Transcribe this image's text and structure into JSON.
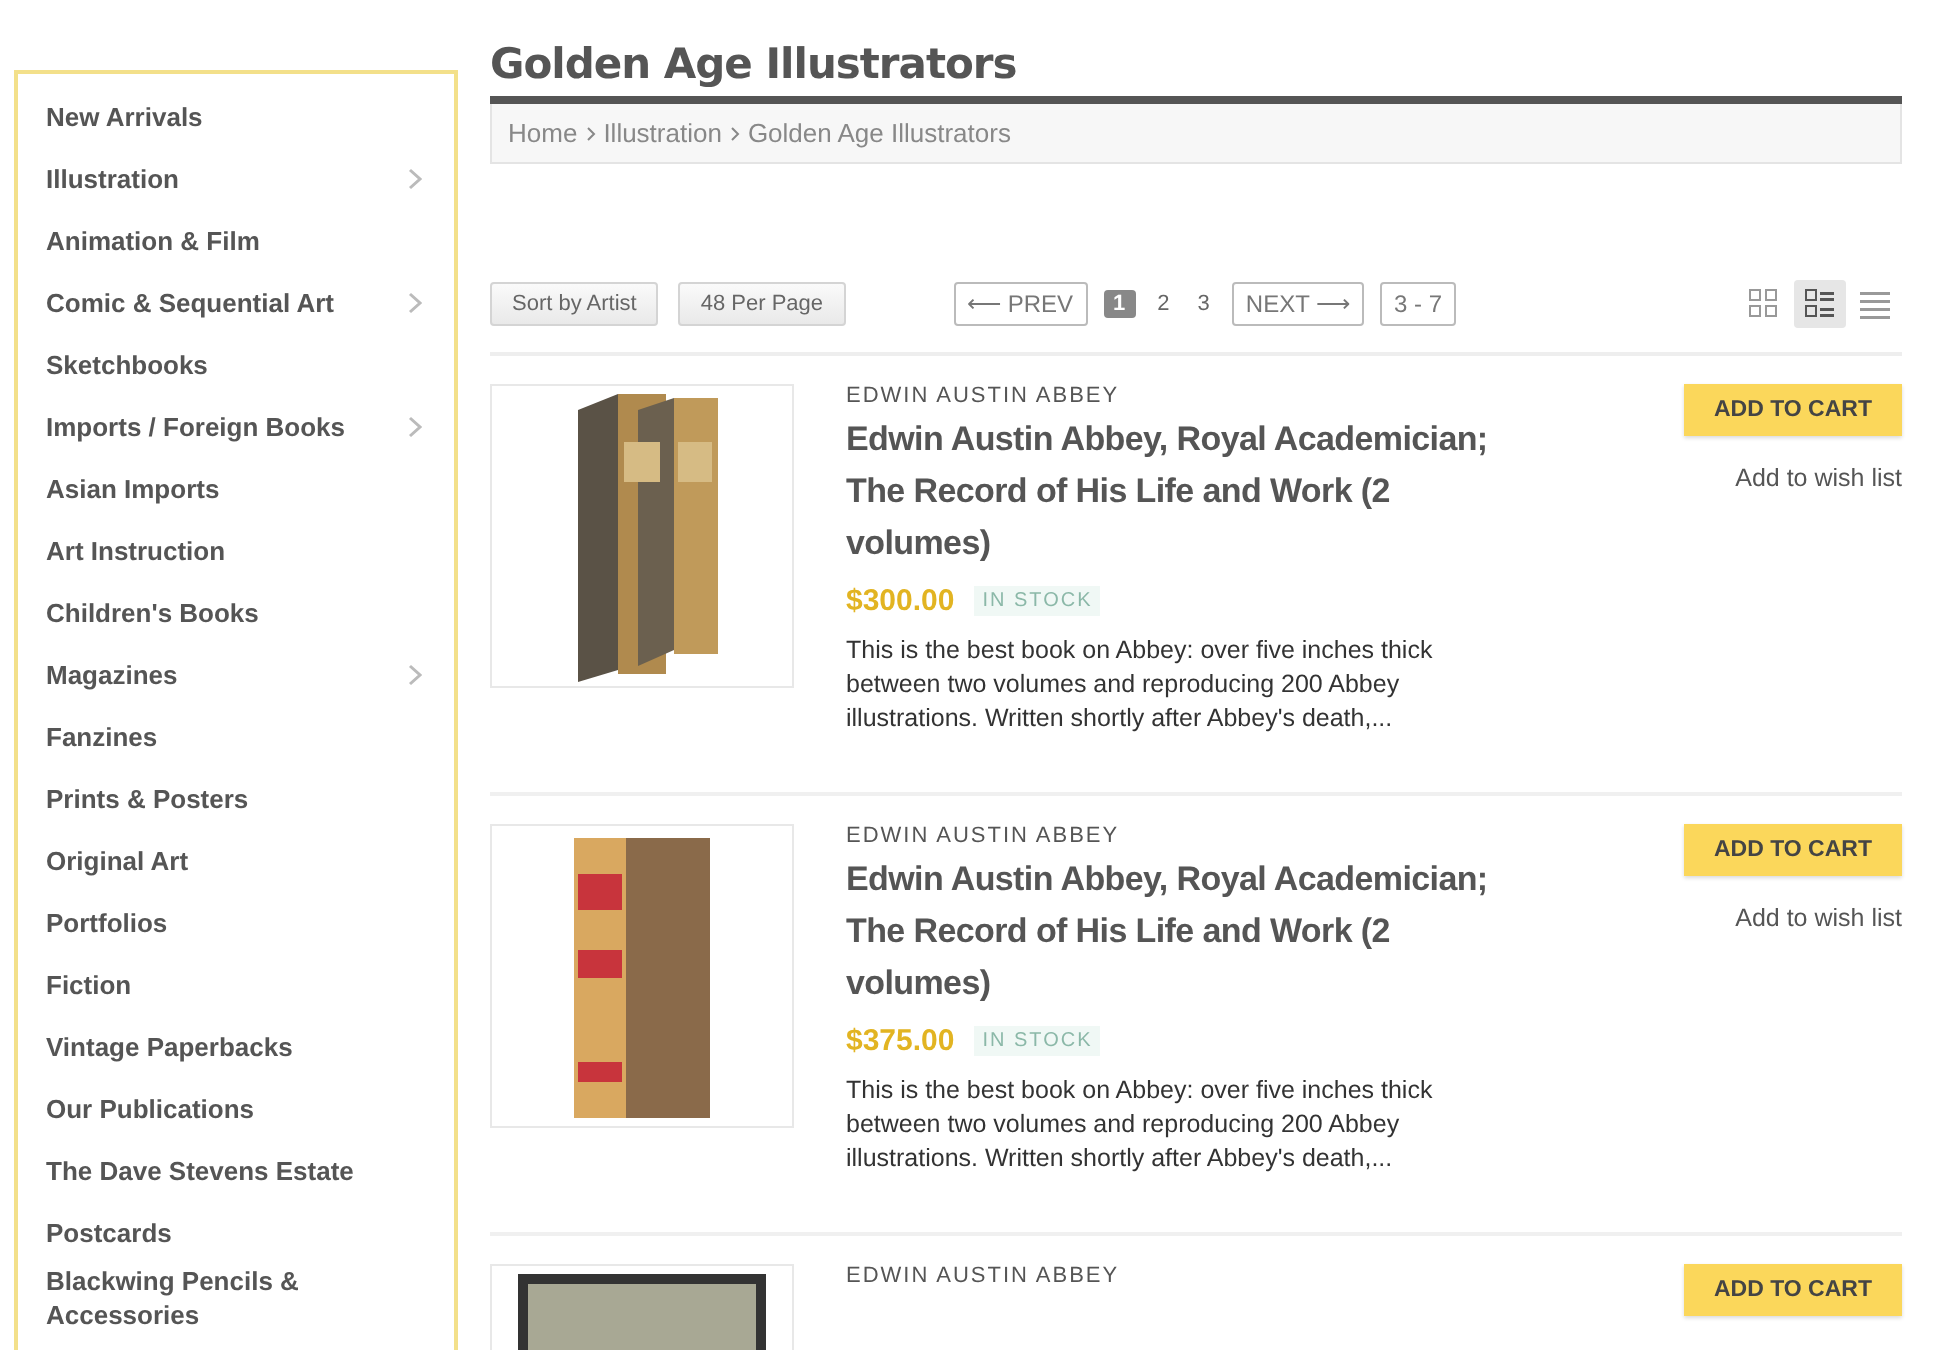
{
  "sidebar": {
    "items": [
      {
        "label": "New Arrivals",
        "expandable": false
      },
      {
        "label": "Illustration",
        "expandable": true
      },
      {
        "label": "Animation & Film",
        "expandable": false
      },
      {
        "label": "Comic & Sequential Art",
        "expandable": true
      },
      {
        "label": "Sketchbooks",
        "expandable": false
      },
      {
        "label": "Imports / Foreign Books",
        "expandable": true
      },
      {
        "label": "Asian Imports",
        "expandable": false
      },
      {
        "label": "Art Instruction",
        "expandable": false
      },
      {
        "label": "Children's Books",
        "expandable": false
      },
      {
        "label": "Magazines",
        "expandable": true
      },
      {
        "label": "Fanzines",
        "expandable": false
      },
      {
        "label": "Prints & Posters",
        "expandable": false
      },
      {
        "label": "Original Art",
        "expandable": false
      },
      {
        "label": "Portfolios",
        "expandable": false
      },
      {
        "label": "Fiction",
        "expandable": false
      },
      {
        "label": "Vintage Paperbacks",
        "expandable": false
      },
      {
        "label": "Our Publications",
        "expandable": false
      },
      {
        "label": "The Dave Stevens Estate",
        "expandable": false
      },
      {
        "label": "Postcards",
        "expandable": false
      },
      {
        "label": "Blackwing Pencils & Accessories",
        "expandable": false
      }
    ]
  },
  "page_title": "Golden Age Illustrators",
  "breadcrumb": [
    "Home",
    "Illustration",
    "Golden Age Illustrators"
  ],
  "toolbar": {
    "sort": "Sort by Artist",
    "per_page": "48 Per Page",
    "prev": "⟵ PREV",
    "pages": [
      {
        "label": "1",
        "selected": true
      },
      {
        "label": "2",
        "selected": false
      },
      {
        "label": "3",
        "selected": false
      }
    ],
    "next": "NEXT ⟶",
    "range": "3 - 7",
    "views": [
      {
        "kind": "grid",
        "selected": false
      },
      {
        "kind": "detail",
        "selected": true
      },
      {
        "kind": "list",
        "selected": false
      }
    ]
  },
  "products": [
    {
      "kind": "two-volumes",
      "author": "EDWIN AUSTIN ABBEY",
      "title": "Edwin Austin Abbey, Royal Academician; The Record of His Life and Work (2 volumes)",
      "price": "$300.00",
      "stock": "IN STOCK",
      "description": "This is the best book on Abbey: over five inches thick between two volumes and reproducing 200 Abbey illustrations. Written shortly after Abbey's death,...",
      "cart": "ADD TO CART",
      "wishlist": "Add to wish list"
    },
    {
      "kind": "single-volume",
      "author": "EDWIN AUSTIN ABBEY",
      "title": "Edwin Austin Abbey, Royal Academician; The Record of His Life and Work (2 volumes)",
      "price": "$375.00",
      "stock": "IN STOCK",
      "description": "This is the best book on Abbey: over five inches thick between two volumes and reproducing 200 Abbey illustrations. Written shortly after Abbey's death,...",
      "cart": "ADD TO CART",
      "wishlist": "Add to wish list"
    },
    {
      "kind": "framed",
      "author": "EDWIN AUSTIN ABBEY",
      "cart": "ADD TO CART"
    }
  ]
}
